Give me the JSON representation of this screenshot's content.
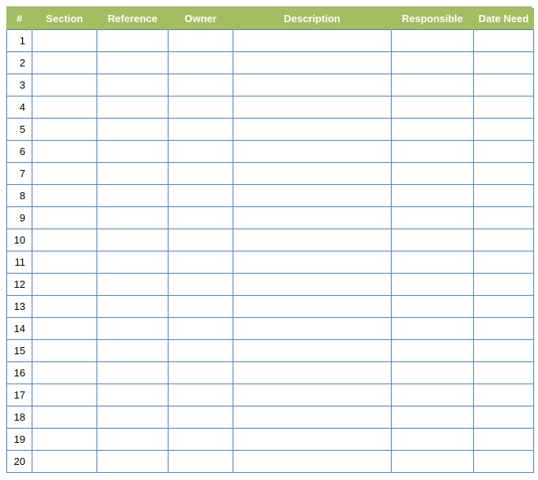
{
  "table": {
    "headers": {
      "num": "#",
      "section": "Section",
      "reference": "Reference",
      "owner": "Owner",
      "description": "Description",
      "responsible": "Responsible",
      "date_need": "Date Need"
    },
    "rows": [
      {
        "num": "1",
        "section": "",
        "reference": "",
        "owner": "",
        "description": "",
        "responsible": "",
        "date_need": ""
      },
      {
        "num": "2",
        "section": "",
        "reference": "",
        "owner": "",
        "description": "",
        "responsible": "",
        "date_need": ""
      },
      {
        "num": "3",
        "section": "",
        "reference": "",
        "owner": "",
        "description": "",
        "responsible": "",
        "date_need": ""
      },
      {
        "num": "4",
        "section": "",
        "reference": "",
        "owner": "",
        "description": "",
        "responsible": "",
        "date_need": ""
      },
      {
        "num": "5",
        "section": "",
        "reference": "",
        "owner": "",
        "description": "",
        "responsible": "",
        "date_need": ""
      },
      {
        "num": "6",
        "section": "",
        "reference": "",
        "owner": "",
        "description": "",
        "responsible": "",
        "date_need": ""
      },
      {
        "num": "7",
        "section": "",
        "reference": "",
        "owner": "",
        "description": "",
        "responsible": "",
        "date_need": ""
      },
      {
        "num": "8",
        "section": "",
        "reference": "",
        "owner": "",
        "description": "",
        "responsible": "",
        "date_need": ""
      },
      {
        "num": "9",
        "section": "",
        "reference": "",
        "owner": "",
        "description": "",
        "responsible": "",
        "date_need": ""
      },
      {
        "num": "10",
        "section": "",
        "reference": "",
        "owner": "",
        "description": "",
        "responsible": "",
        "date_need": ""
      },
      {
        "num": "11",
        "section": "",
        "reference": "",
        "owner": "",
        "description": "",
        "responsible": "",
        "date_need": ""
      },
      {
        "num": "12",
        "section": "",
        "reference": "",
        "owner": "",
        "description": "",
        "responsible": "",
        "date_need": ""
      },
      {
        "num": "13",
        "section": "",
        "reference": "",
        "owner": "",
        "description": "",
        "responsible": "",
        "date_need": ""
      },
      {
        "num": "14",
        "section": "",
        "reference": "",
        "owner": "",
        "description": "",
        "responsible": "",
        "date_need": ""
      },
      {
        "num": "15",
        "section": "",
        "reference": "",
        "owner": "",
        "description": "",
        "responsible": "",
        "date_need": ""
      },
      {
        "num": "16",
        "section": "",
        "reference": "",
        "owner": "",
        "description": "",
        "responsible": "",
        "date_need": ""
      },
      {
        "num": "17",
        "section": "",
        "reference": "",
        "owner": "",
        "description": "",
        "responsible": "",
        "date_need": ""
      },
      {
        "num": "18",
        "section": "",
        "reference": "",
        "owner": "",
        "description": "",
        "responsible": "",
        "date_need": ""
      },
      {
        "num": "19",
        "section": "",
        "reference": "",
        "owner": "",
        "description": "",
        "responsible": "",
        "date_need": ""
      },
      {
        "num": "20",
        "section": "",
        "reference": "",
        "owner": "",
        "description": "",
        "responsible": "",
        "date_need": ""
      }
    ]
  }
}
